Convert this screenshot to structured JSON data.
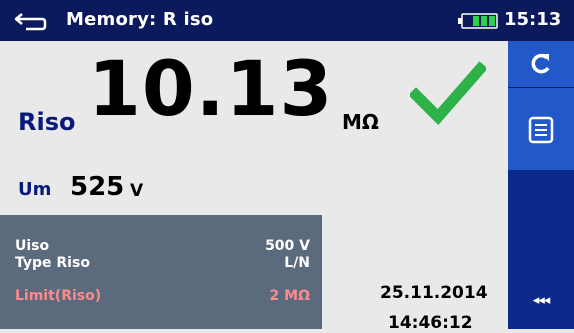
{
  "header": {
    "title": "Memory: R iso",
    "clock": "15:13"
  },
  "main_result": {
    "label": "Riso",
    "value": "10.13",
    "unit": "MΩ",
    "status": "pass"
  },
  "sub_result": {
    "label": "Um",
    "value": "525",
    "unit": "V"
  },
  "parameters": [
    {
      "name": "Uiso",
      "value": "500 V"
    },
    {
      "name": "Type Riso",
      "value": "L/N"
    },
    {
      "name": "Limit(Riso)",
      "value": "2 MΩ"
    }
  ],
  "timestamp": {
    "date": "25.11.2014",
    "time": "14:46:12"
  },
  "side_panel": {
    "more_label": "◂◂◂"
  },
  "colors": {
    "header_bg": "#0a1a5c",
    "side_bg": "#0c2a8c",
    "side_button_bg": "#2358c8",
    "label_blue": "#0a1a7c",
    "pass_green": "#2fb14a",
    "limit_red": "#ff8a8a",
    "params_bg": "#5c6a7e"
  },
  "icons": {
    "back": "return-arrow-icon",
    "battery": "battery-icon",
    "pass": "checkmark-icon",
    "retest": "refresh-icon",
    "details": "list-icon",
    "more": "more-options-icon"
  }
}
